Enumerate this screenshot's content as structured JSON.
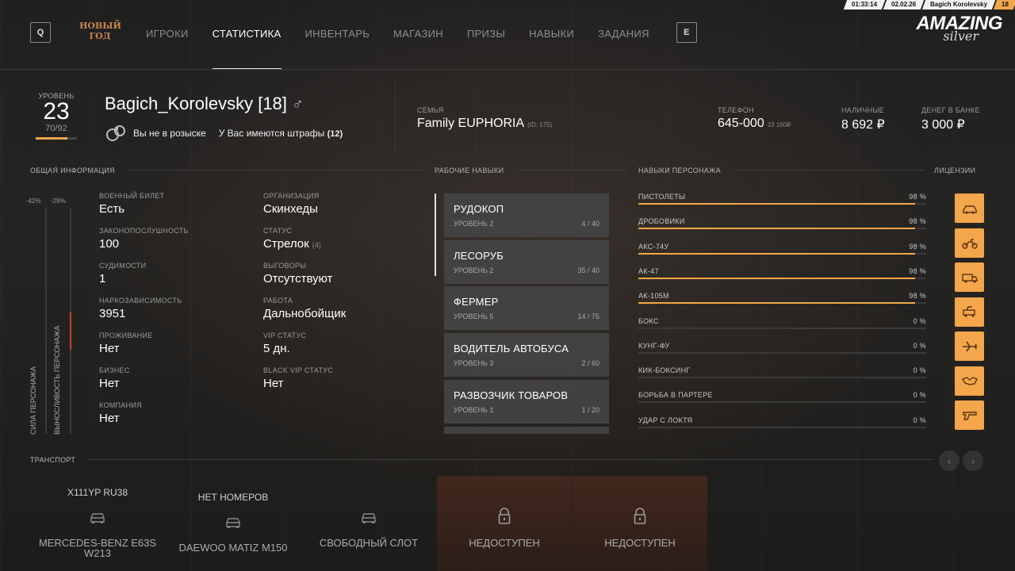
{
  "topbar": {
    "time": "01:33:14",
    "date": "02.02.26",
    "username": "Bagich Korolevsky",
    "level": "18"
  },
  "nav": {
    "key_left": "Q",
    "event_logo_text": "НОВЫЙ ГОД",
    "items": [
      "ИГРОКИ",
      "СТАТИСТИКА",
      "ИНВЕНТАРЬ",
      "МАГАЗИН",
      "ПРИЗЫ",
      "НАВЫКИ",
      "ЗАДАНИЯ"
    ],
    "active_index": 1,
    "key_right": "E"
  },
  "brand": {
    "name": "AMAZING",
    "sub": "silver"
  },
  "level": {
    "label": "УРОВЕНЬ",
    "value": "23",
    "xp": "70/92",
    "progress": 0.76
  },
  "player": {
    "name": "Bagich_Korolevsky [18]",
    "gender_symbol": "♂",
    "wanted": "Вы не в розыске",
    "fines_text": "У Вас имеются штрафы",
    "fines_count": "(12)"
  },
  "header_stats": {
    "family": {
      "label": "СЕМЬЯ",
      "value": "Family EUPHORIA",
      "id": "(ID: 175)"
    },
    "phone": {
      "label": "ТЕЛЕФОН",
      "value": "645-000",
      "extra": "33 160₽"
    },
    "cash": {
      "label": "НАЛИЧНЫЕ",
      "value": "8 692 ₽"
    },
    "bank": {
      "label": "ДЕНЕГ В БАНКЕ",
      "value": "3 000 ₽"
    }
  },
  "sections": {
    "general": "ОБЩАЯ ИНФОРМАЦИЯ",
    "work_skills": "РАБОЧИЕ НАВЫКИ",
    "char_skills": "НАВЫКИ ПЕРСОНАЖА",
    "licenses": "ЛИЦЕНЗИИ",
    "transport": "ТРАНСПОРТ"
  },
  "char_bars": {
    "strength": {
      "label": "СИЛА ПЕРСОНАЖА",
      "pct": "-42%"
    },
    "stamina": {
      "label": "ВЫНОСЛИВОСТЬ ПЕРСОНАЖА",
      "pct": "-29%"
    }
  },
  "general_left": [
    {
      "label": "ВОЕННЫЙ БИЛЕТ",
      "value": "Есть"
    },
    {
      "label": "ЗАКОНОПОСЛУШНОСТЬ",
      "value": "100"
    },
    {
      "label": "СУДИМОСТИ",
      "value": "1"
    },
    {
      "label": "НАРКОЗАВИСИМОСТЬ",
      "value": "3951"
    },
    {
      "label": "ПРОЖИВАНИЕ",
      "value": "Нет"
    },
    {
      "label": "БИЗНЕС",
      "value": "Нет"
    },
    {
      "label": "КОМПАНИЯ",
      "value": "Нет"
    }
  ],
  "general_right": [
    {
      "label": "ОРГАНИЗАЦИЯ",
      "value": "Скинхеды",
      "extra": ""
    },
    {
      "label": "СТАТУС",
      "value": "Стрелок",
      "extra": "(4)"
    },
    {
      "label": "ВЫГОВОРЫ",
      "value": "Отсутствуют",
      "extra": ""
    },
    {
      "label": "РАБОТА",
      "value": "Дальнобойщик",
      "extra": ""
    },
    {
      "label": "VIP СТАТУС",
      "value": "5 дн.",
      "extra": ""
    },
    {
      "label": "BLACK VIP СТАТУС",
      "value": "Нет",
      "extra": ""
    }
  ],
  "work_skills": [
    {
      "name": "РУДОКОП",
      "level": "УРОВЕНЬ 2",
      "progress": "4 / 40"
    },
    {
      "name": "ЛЕСОРУБ",
      "level": "УРОВЕНЬ 2",
      "progress": "35 / 40"
    },
    {
      "name": "ФЕРМЕР",
      "level": "УРОВЕНЬ 5",
      "progress": "14 / 75"
    },
    {
      "name": "ВОДИТЕЛЬ АВТОБУСА",
      "level": "УРОВЕНЬ 3",
      "progress": "2 / 60"
    },
    {
      "name": "РАЗВОЗЧИК ТОВАРОВ",
      "level": "УРОВЕНЬ 1",
      "progress": "1 / 20"
    }
  ],
  "char_skills": [
    {
      "name": "ПИСТОЛЕТЫ",
      "value": "98 %",
      "fill": 0.98
    },
    {
      "name": "ДРОБОВИКИ",
      "value": "98 %",
      "fill": 0.98
    },
    {
      "name": "АКС-74У",
      "value": "98 %",
      "fill": 0.98
    },
    {
      "name": "АК-47",
      "value": "98 %",
      "fill": 0.98
    },
    {
      "name": "АК-105М",
      "value": "98 %",
      "fill": 0.98
    },
    {
      "name": "БОКС",
      "value": "0 %",
      "fill": 0
    },
    {
      "name": "КУНГ-ФУ",
      "value": "0 %",
      "fill": 0
    },
    {
      "name": "КИК-БОКСИНГ",
      "value": "0 %",
      "fill": 0
    },
    {
      "name": "БОРЬБА В ПАРТЕРЕ",
      "value": "0 %",
      "fill": 0
    },
    {
      "name": "УДАР С ЛОКТЯ",
      "value": "0 %",
      "fill": 0
    }
  ],
  "licenses": [
    {
      "icon": "car-icon"
    },
    {
      "icon": "motorcycle-icon"
    },
    {
      "icon": "truck-icon"
    },
    {
      "icon": "tow-truck-icon"
    },
    {
      "icon": "airplane-icon"
    },
    {
      "icon": "handshake-icon"
    },
    {
      "icon": "pistol-icon"
    }
  ],
  "transport": {
    "prev": "‹",
    "next": "›",
    "slots": [
      {
        "plate": "X111YP RU38",
        "name": "MERCEDES-BENZ E63S W213",
        "icon": "car-icon",
        "locked": false
      },
      {
        "plate": "НЕТ НОМЕРОВ",
        "name": "DAEWOO MATIZ M150",
        "icon": "car-icon",
        "locked": false
      },
      {
        "plate": "",
        "name": "СВОБОДНЫЙ СЛОТ",
        "icon": "car-icon",
        "locked": false
      },
      {
        "plate": "",
        "name": "НЕДОСТУПЕН",
        "icon": "lock-icon",
        "locked": true
      },
      {
        "plate": "",
        "name": "НЕДОСТУПЕН",
        "icon": "lock-icon",
        "locked": true
      }
    ]
  },
  "colors": {
    "accent": "#f3a64b",
    "danger": "#c2452e"
  }
}
